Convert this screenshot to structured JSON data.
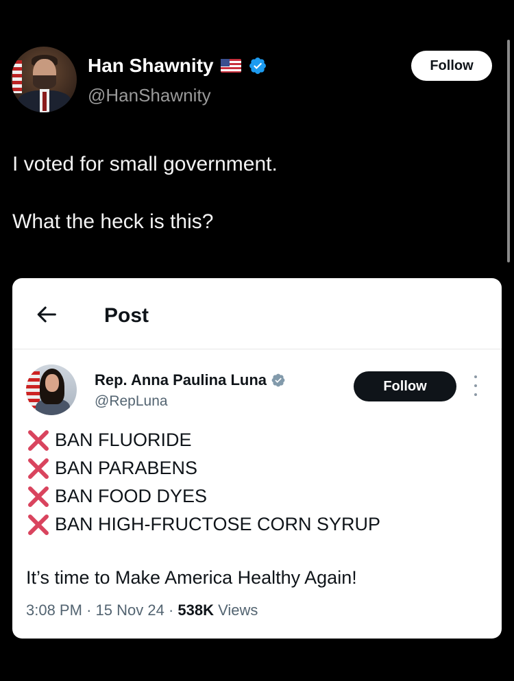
{
  "outer_tweet": {
    "author_name": "Han Shawnity",
    "author_handle": "@HanShawnity",
    "follow_label": "Follow",
    "text_lines": [
      "I voted for small government.",
      "What the heck is this?"
    ]
  },
  "quoted_post": {
    "page_title": "Post",
    "author_name": "Rep. Anna Paulina Luna",
    "author_handle": "@RepLuna",
    "follow_label": "Follow",
    "ban_items": [
      "BAN FLUORIDE",
      "BAN PARABENS",
      "BAN FOOD DYES",
      "BAN HIGH-FRUCTOSE CORN SYRUP"
    ],
    "tagline": "It’s time to Make America Healthy Again!",
    "time": "3:08 PM",
    "date": "15 Nov 24",
    "views_count": "538K",
    "views_label": "Views",
    "separator": "·"
  },
  "colors": {
    "background": "#000000",
    "verified_blue": "#1d9bf0",
    "verified_gray": "#829aab",
    "cross_red": "#d9445e"
  }
}
